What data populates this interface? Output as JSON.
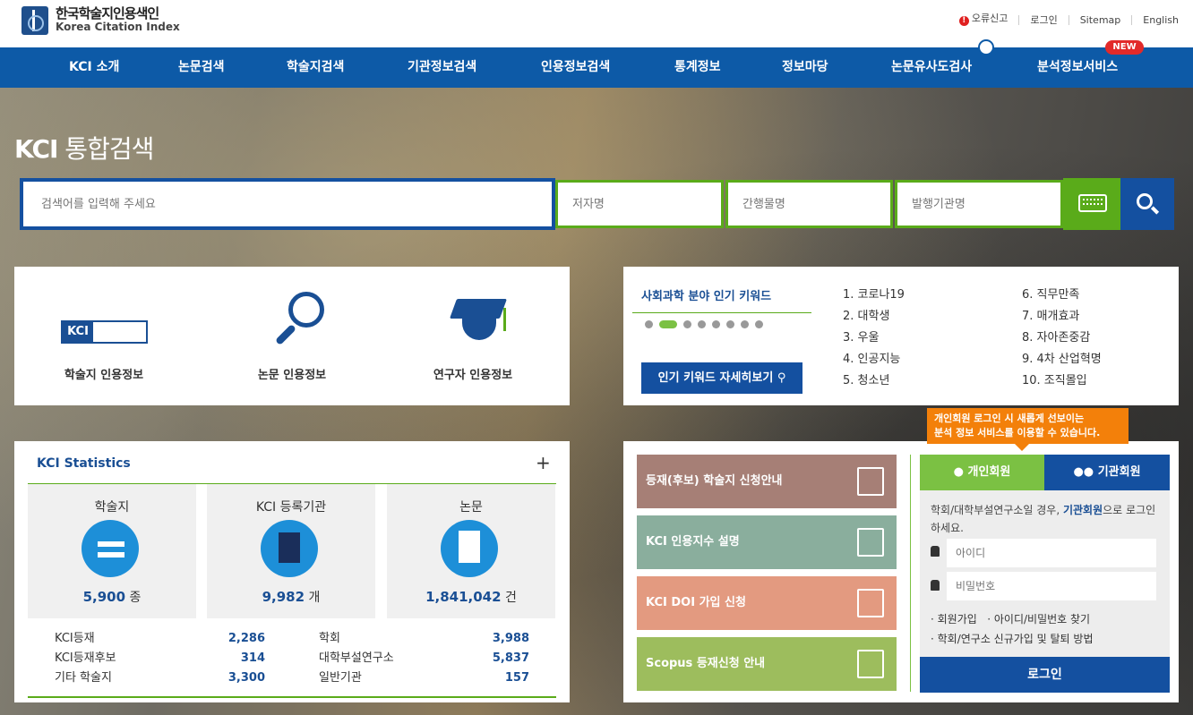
{
  "header": {
    "logo_kr": "한국학술지인용색인",
    "logo_en": "Korea Citation Index",
    "util": [
      "오류신고",
      "로그인",
      "Sitemap",
      "English"
    ]
  },
  "nav": {
    "items": [
      "KCI 소개",
      "논문검색",
      "학술지검색",
      "기관정보검색",
      "인용정보검색",
      "통계정보",
      "정보마당",
      "논문유사도검사",
      "분석정보서비스"
    ],
    "new_badge": "NEW"
  },
  "search": {
    "title_bold": "KCI",
    "title_rest": " 통합검색",
    "main_placeholder": "검색어를 입력해 주세요",
    "author_placeholder": "저자명",
    "journal_placeholder": "간행물명",
    "publisher_placeholder": "발행기관명"
  },
  "citation": {
    "items": [
      "학술지 인용정보",
      "논문 인용정보",
      "연구자 인용정보"
    ],
    "kci_badge": "KCI"
  },
  "keywords": {
    "title": "사회과학 분야 인기 키워드",
    "button": "인기 키워드 자세히보기",
    "col1": [
      "1. 코로나19",
      "2. 대학생",
      "3. 우울",
      "4. 인공지능",
      "5. 청소년"
    ],
    "col2": [
      "6. 직무만족",
      "7. 매개효과",
      "8. 자아존중감",
      "9. 4차 산업혁명",
      "10. 조직몰입"
    ]
  },
  "stats": {
    "title": "KCI Statistics",
    "plus": "+",
    "boxes": [
      {
        "label": "학술지",
        "value": "5,900",
        "unit": " 종"
      },
      {
        "label": "KCI 등록기관",
        "value": "9,982",
        "unit": " 개"
      },
      {
        "label": "논문",
        "value": "1,841,042",
        "unit": " 건"
      }
    ],
    "rows": [
      {
        "a": "KCI등재",
        "av": "2,286",
        "b": "학회",
        "bv": "3,988"
      },
      {
        "a": "KCI등재후보",
        "av": "314",
        "b": "대학부설연구소",
        "bv": "5,837"
      },
      {
        "a": "기타 학술지",
        "av": "3,300",
        "b": "일반기관",
        "bv": "157"
      }
    ]
  },
  "services": [
    {
      "label": "등재(후보) 학술지 신청안내",
      "color": "#a67f76"
    },
    {
      "label": "KCI 인용지수 설명",
      "color": "#8aae9d"
    },
    {
      "label": "KCI DOI 가입 신청",
      "color": "#e39a80"
    },
    {
      "label": "Scopus 등재신청 안내",
      "color": "#9dbd5d"
    }
  ],
  "login": {
    "tooltip_line1": "개인회원 로그인 시 새롭게 선보이는",
    "tooltip_line2": "분석 정보 서비스를 이용할 수 있습니다.",
    "tab_personal": "개인회원",
    "tab_institution": "기관회원",
    "desc_pre": "학회/대학부설연구소일 경우, ",
    "desc_link": "기관회원",
    "desc_post": "으로 로그인 하세요.",
    "id_placeholder": "아이디",
    "pw_placeholder": "비밀번호",
    "link1": "· 회원가입",
    "link2": "· 아이디/비밀번호 찾기",
    "link3": "· 학회/연구소 신규가입 및 탈퇴 방법",
    "button": "로그인"
  }
}
